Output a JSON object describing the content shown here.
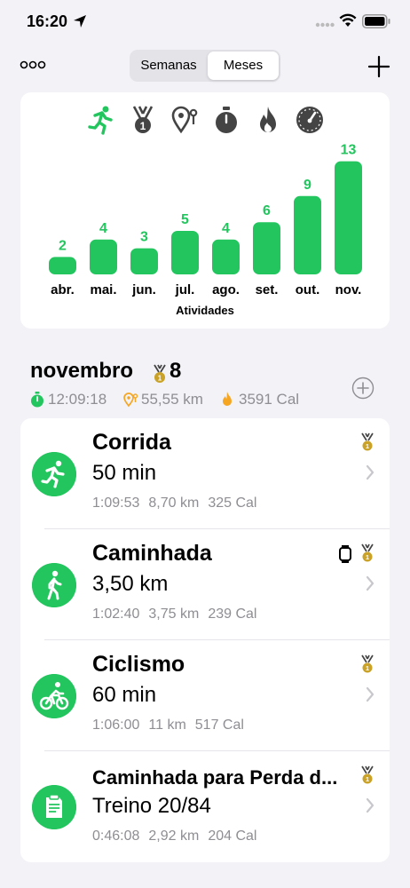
{
  "status": {
    "time": "16:20"
  },
  "nav": {
    "segments": [
      "Semanas",
      "Meses"
    ],
    "selected": "Meses"
  },
  "metrics": [
    "running-icon",
    "medal-icon",
    "distance-icon",
    "timer-icon",
    "flame-icon",
    "speedometer-icon"
  ],
  "chart_data": {
    "type": "bar",
    "categories": [
      "abr.",
      "mai.",
      "jun.",
      "jul.",
      "ago.",
      "set.",
      "out.",
      "nov."
    ],
    "values": [
      2,
      4,
      3,
      5,
      4,
      6,
      9,
      13
    ],
    "title": "",
    "xlabel": "Atividades",
    "ylabel": "",
    "color": "#23c55e",
    "grid": false
  },
  "month": {
    "title": "novembro",
    "medal_count": "8",
    "duration": "12:09:18",
    "distance": "55,55 km",
    "calories": "3591 Cal"
  },
  "activities": [
    {
      "title": "Corrida",
      "main": "50 min",
      "time": "1:09:53",
      "distance": "8,70 km",
      "calories": "325 Cal",
      "icon": "running-icon",
      "watch": false
    },
    {
      "title": "Caminhada",
      "main": "3,50 km",
      "time": "1:02:40",
      "distance": "3,75 km",
      "calories": "239 Cal",
      "icon": "walking-icon",
      "watch": true
    },
    {
      "title": "Ciclismo",
      "main": "60 min",
      "time": "1:06:00",
      "distance": "11 km",
      "calories": "517 Cal",
      "icon": "cycling-icon",
      "watch": false
    },
    {
      "title": "Caminhada para Perda d...",
      "main": "Treino 20/84",
      "time": "0:46:08",
      "distance": "2,92 km",
      "calories": "204 Cal",
      "icon": "workout-plan-icon",
      "watch": false
    }
  ],
  "colors": {
    "accent": "#23c55e",
    "orange": "#f5a623",
    "gold": "#c9a227",
    "muted": "#8e8e93"
  }
}
